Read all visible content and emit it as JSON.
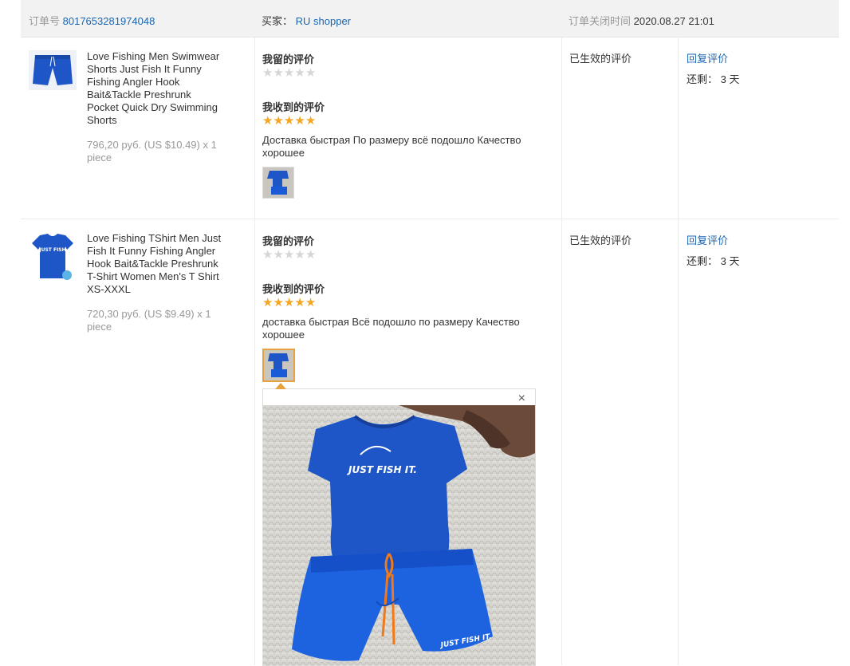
{
  "header": {
    "order_label": "订单号",
    "order_number": "8017653281974048",
    "buyer_label": "买家：",
    "buyer_name": "RU shopper",
    "closed_label": "订单关闭时间",
    "closed_time": "2020.08.27 21:01"
  },
  "items": [
    {
      "title": "Love Fishing Men Swimwear Shorts Just Fish It Funny Fishing Angler Hook Bait&Tackle Preshrunk Pocket Quick Dry Swimming Shorts",
      "price": "796,20 руб. (US $10.49) x 1 piece",
      "my_review_label": "我留的评价",
      "my_stars": 0,
      "received_label": "我收到的评价",
      "received_stars": 5,
      "review_text": "Доставка быстрая По размеру всё подошло Качество хорошее",
      "status": "已生效的评价",
      "reply_label": "回复评价",
      "remaining_label": "还剩：",
      "remaining_value": "3 天"
    },
    {
      "title": "Love Fishing TShirt Men Just Fish It Funny Fishing Angler Hook Bait&Tackle Preshrunk T-Shirt Women Men's T Shirt XS-XXXL",
      "price": "720,30 руб. (US $9.49) x 1 piece",
      "my_review_label": "我留的评价",
      "my_stars": 0,
      "received_label": "我收到的评价",
      "received_stars": 5,
      "review_text": "доставка быстрая Всё подошло по размеру Качество хорошее",
      "status": "已生效的评价",
      "reply_label": "回复评价",
      "remaining_label": "还剩：",
      "remaining_value": "3 天"
    }
  ],
  "popup": {
    "close_symbol": "×",
    "shirt_print": "JUST FISH IT.",
    "shorts_print": "JUST FISH IT."
  },
  "colors": {
    "link": "#1a66b3",
    "star_full": "#f5a623",
    "star_empty": "#d6d6d6",
    "product_blue": "#1e56c8"
  },
  "icons": {
    "star": "★",
    "close": "close-icon"
  }
}
